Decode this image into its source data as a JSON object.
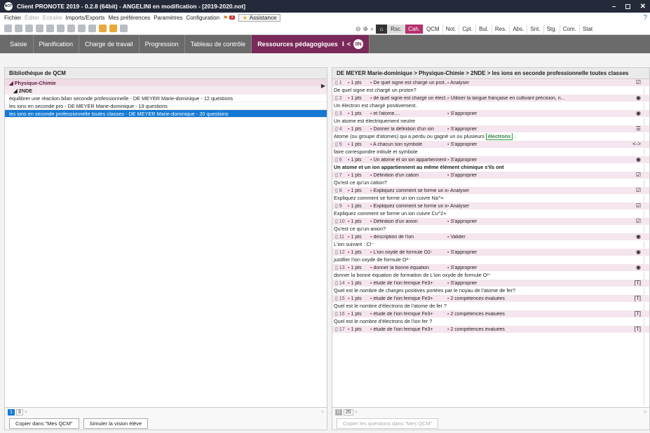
{
  "window": {
    "title": "Client PRONOTE 2019 - 0.2.8 (64bit) - ANGELINI en modification - [2019-2020.not]",
    "logo": "NOT",
    "controls": [
      "–",
      "◻",
      "✕"
    ]
  },
  "menu": {
    "items": [
      "Fichier",
      "Éditer",
      "Extraire",
      "Imports/Exports",
      "Mes préférences",
      "Paramètres",
      "Configuration"
    ],
    "badge": "3",
    "assistance": "Assistance",
    "help": "?"
  },
  "navtabs": [
    "Rsc.",
    "Cah.",
    "QCM",
    "Not.",
    "Cpt.",
    "Bul.",
    "Res.",
    "Abs.",
    "Snt.",
    "Stg.",
    "Com.",
    "Stat"
  ],
  "modules": [
    "Saisie",
    "Planification",
    "Charge de travail",
    "Progression",
    "Tableau de contrôle",
    "Ressources pédagogiques"
  ],
  "left": {
    "header": "Bibliothèque de QCM",
    "subject": "Physique-Chimie",
    "class": "2NDE",
    "items": [
      "équilibrer une réaction bilan seconde professionnelle - DE MEYER Marie-dominique - 12 questions",
      "les ions en seconde pro - DE MEYER Marie-dominique - 19 questions",
      "les ions en seconde professionnelle toutes classes - DE MEYER Marie-dominique - 20 questions"
    ],
    "pages": [
      "1",
      "3",
      "<",
      ">"
    ],
    "buttons": [
      "Copier dans \"Mes QCM\"",
      "Simuler la vision élève"
    ]
  },
  "right": {
    "header": "DE MEYER Marie-dominique > Physique-Chimie > 2NDE > les ions en seconde professionnelle toutes classes",
    "questions": [
      {
        "num": "1",
        "pts": "1 pts",
        "label": "De quel signe est chargé un prot...",
        "comp": "Analyser",
        "type": "☑",
        "text": "De quel signe est chargé un proton?"
      },
      {
        "num": "2",
        "pts": "1 pts",
        "label": "de quel signe est chargé un élect...",
        "comp": "Utiliser la langue française en cultivant précision, ri...",
        "type": "◉",
        "text": "Un électron est chargé positivement."
      },
      {
        "num": "3",
        "pts": "1 pts",
        "label": "et l'atome....",
        "comp": "S'approprier",
        "type": "◉",
        "text": "Un atome est électriquement neutre"
      },
      {
        "num": "4",
        "pts": "1 pts",
        "label": "Donner la définition d'un ion",
        "comp": "S'approprier",
        "type": "☰",
        "text": "Atome (ou groupe d'atomes) qui a perdu ou gagné un ou plusieurs",
        "hl": "électrons"
      },
      {
        "num": "5",
        "pts": "1 pts",
        "label": "A chacun son symbole",
        "comp": "S'approprier",
        "type": "<->",
        "text": "faire correspondre intitulé et symbole"
      },
      {
        "num": "6",
        "pts": "1 pts",
        "label": "Un atome et un ion appartiennent au même élé...",
        "comp": "S'approprier",
        "type": "◉",
        "text": "Un atome et un ion appartiennent au même élément chimique s'ils ont",
        "bold": true
      },
      {
        "num": "7",
        "pts": "1 pts",
        "label": "Définition d'un cation",
        "comp": "S'approprier",
        "type": "☑",
        "text": "Qu'est ce qu'un cation?"
      },
      {
        "num": "8",
        "pts": "1 pts",
        "label": "Expliquez comment se forme un ion cu...",
        "comp": "Analyser",
        "type": "☑",
        "text": "Expliquez comment se forme un ion cuivre Na^+"
      },
      {
        "num": "9",
        "pts": "1 pts",
        "label": "Expliquez comment se forme un ion cui...",
        "comp": "Analyser",
        "type": "☑",
        "text": "Expliquez comment se forme un ion cuivre Cu^2+"
      },
      {
        "num": "10",
        "pts": "1 pts",
        "label": "Définition d'un anion",
        "comp": "S'approprier",
        "type": "☑",
        "text": "Qu'est ce qu'un anion?"
      },
      {
        "num": "11",
        "pts": "1 pts",
        "label": "description de l'ion",
        "comp": "Valider",
        "type": "◉",
        "text": "L'ion suivant : Cl⁻"
      },
      {
        "num": "12",
        "pts": "1 pts",
        "label": "L'ion oxyde de formule O2-",
        "comp": "S'approprier",
        "type": "◉",
        "text": "justifier l'ion oxyde de formule O²⁻"
      },
      {
        "num": "13",
        "pts": "1 pts",
        "label": "donner la bonne équation",
        "comp": "S'approprier",
        "type": "◉",
        "text": "donner la bonne équation de formation de L'ion oxyde de formule O²⁻"
      },
      {
        "num": "14",
        "pts": "1 pts",
        "label": "étude de l'ion ferrique Fe3+",
        "comp": "S'approprier",
        "type": "[T]",
        "text": "Quel est le nombre de charges positives portées par le noyau de l'atome de fer?"
      },
      {
        "num": "15",
        "pts": "1 pts",
        "label": "étude de l'ion ferrique Fe3+",
        "comp": "2 compétences évaluées",
        "type": "[T]",
        "text": "Quel est le nombre d'électrons de l'atome de fer ?"
      },
      {
        "num": "16",
        "pts": "1 pts",
        "label": "étude de l'ion ferrique Fe3+",
        "comp": "2 compétences évaluées",
        "type": "[T]",
        "text": "Quel est le nombre d'électrons de l'ion fer ?"
      },
      {
        "num": "17",
        "pts": "1 pts",
        "label": "étude de l'ion ferrique Fe3+",
        "comp": "2 compétences évaluées",
        "type": "[T]",
        "text": ""
      }
    ],
    "pages": [
      "0",
      "20",
      "<",
      ">"
    ],
    "button": "Copier les questions dans \"Mes QCM\""
  }
}
